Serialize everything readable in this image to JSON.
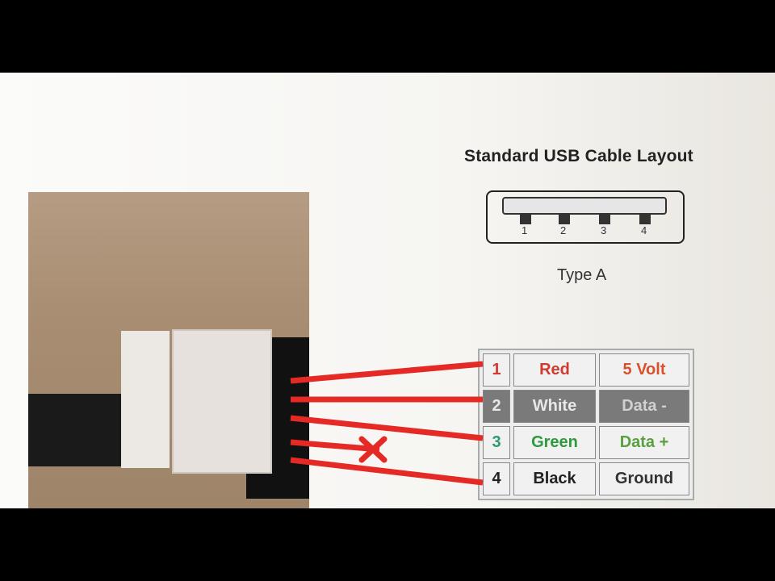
{
  "title": "Standard USB Cable Layout",
  "connector": {
    "label": "Type A",
    "pins": [
      "1",
      "2",
      "3",
      "4"
    ]
  },
  "rows": [
    {
      "num": "1",
      "color": "Red",
      "function": "5 Volt",
      "text_color": "#d03a30"
    },
    {
      "num": "2",
      "color": "White",
      "function": "Data -",
      "text_color": "#eeeeee"
    },
    {
      "num": "3",
      "color": "Green",
      "function": "Data +",
      "text_color": "#2e9a3e"
    },
    {
      "num": "4",
      "color": "Black",
      "function": "Ground",
      "text_color": "#222222"
    }
  ],
  "wire_color": "#e52a25",
  "cross_mark": "x-icon"
}
